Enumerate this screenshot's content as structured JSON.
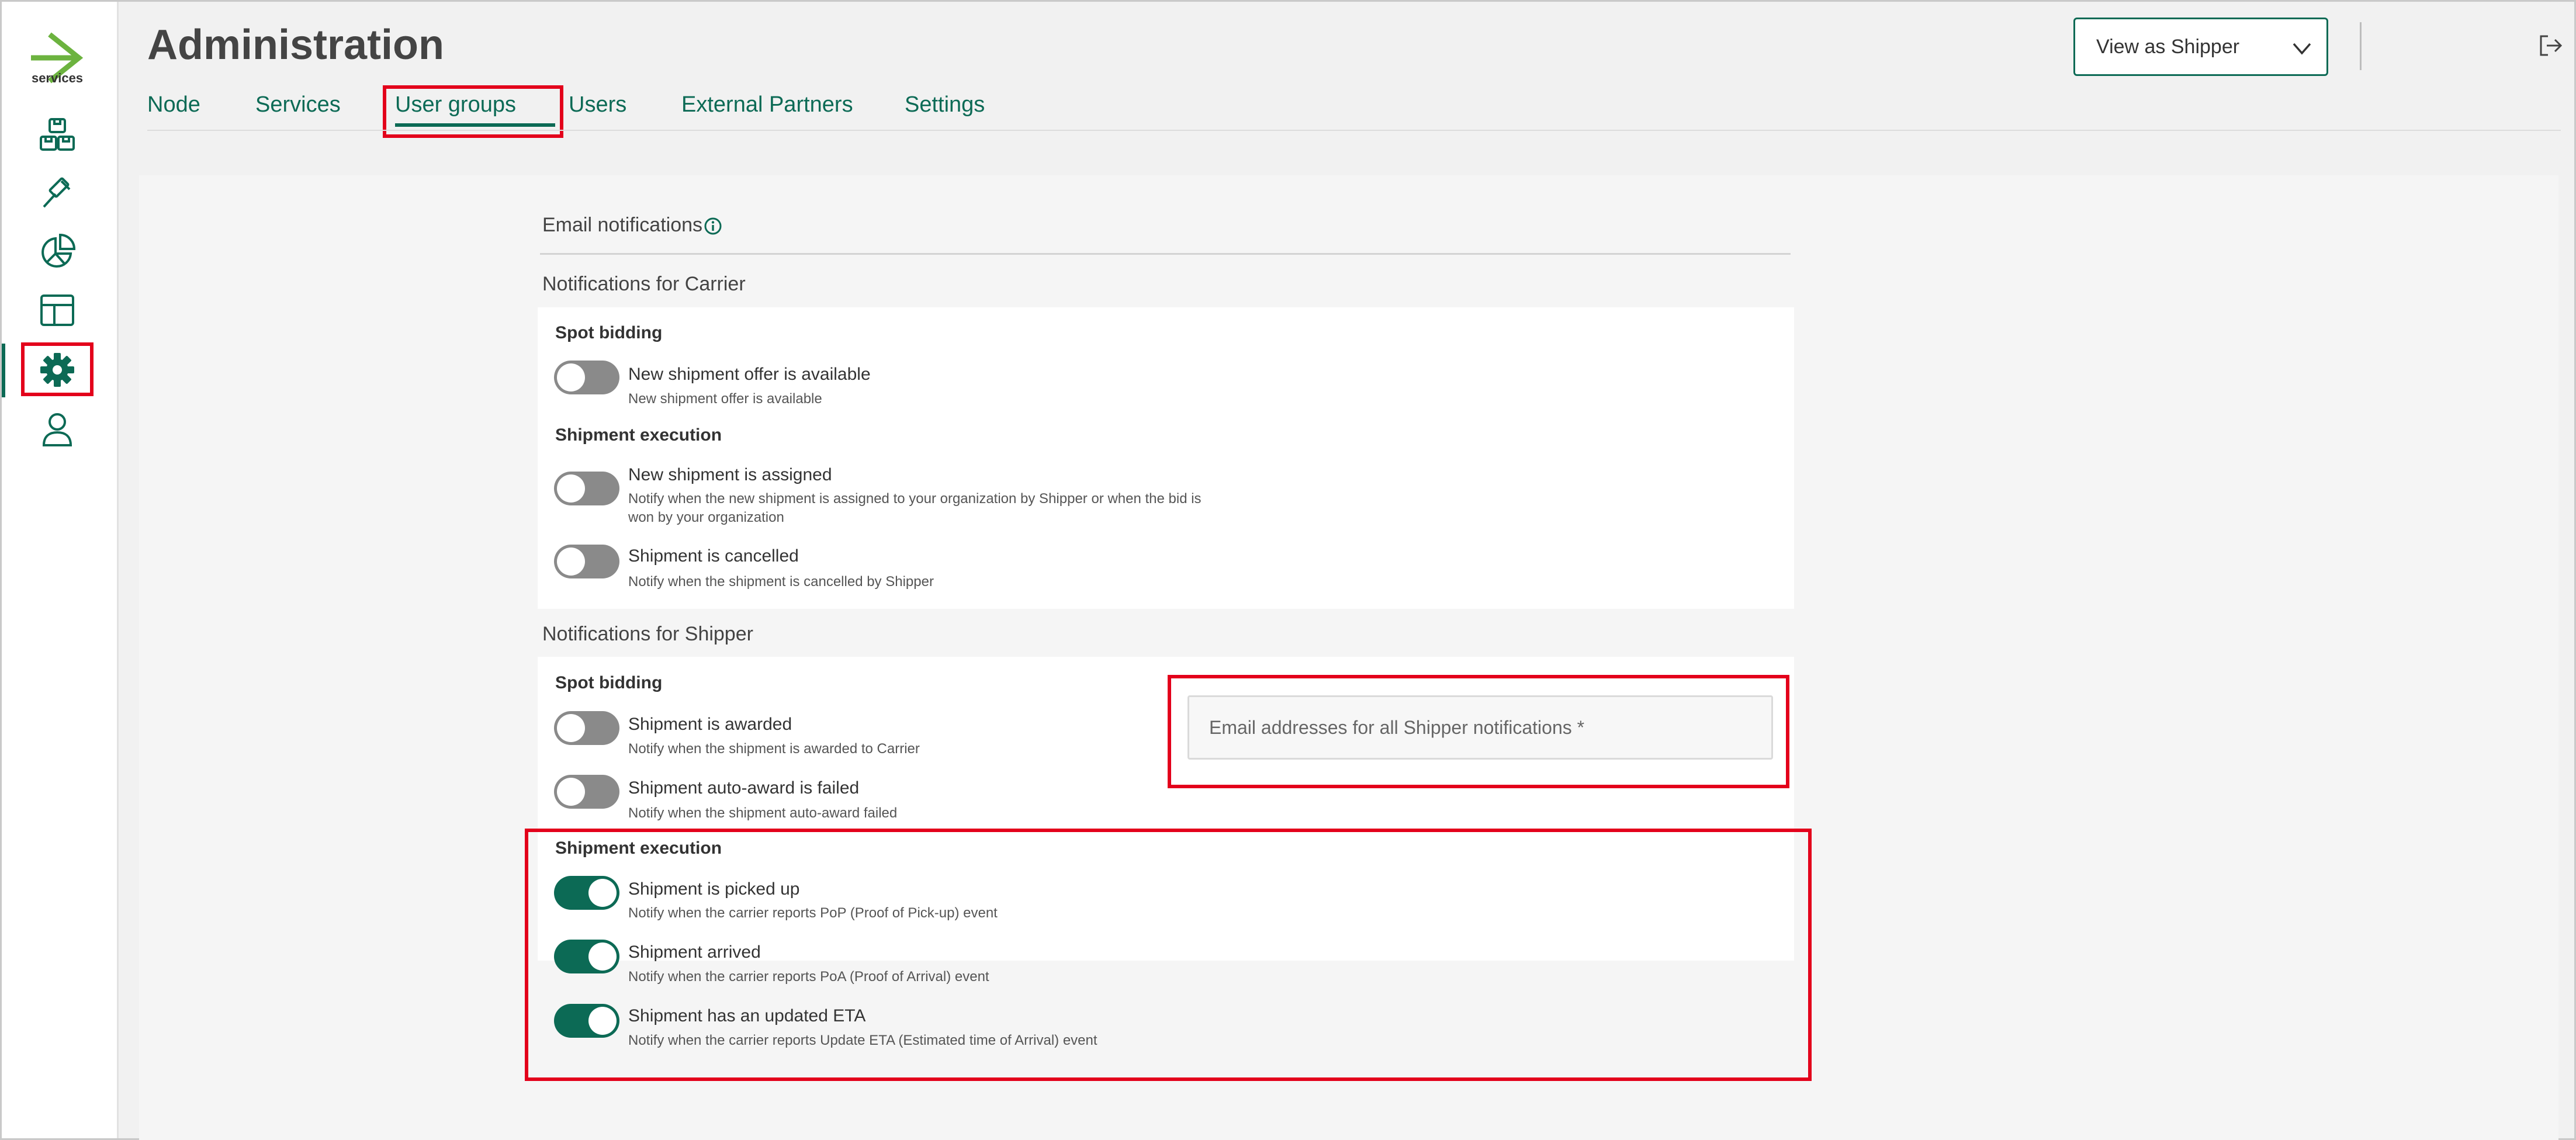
{
  "app": {
    "logo_text": "services",
    "page_title": "Administration"
  },
  "colors": {
    "accent": "#0c6a55",
    "logo_green": "#6cb33f",
    "highlight": "#e3001b"
  },
  "sidebar": {
    "items": [
      {
        "icon": "packages-icon"
      },
      {
        "icon": "gavel-icon"
      },
      {
        "icon": "pie-chart-icon"
      },
      {
        "icon": "layout-icon"
      },
      {
        "icon": "gear-icon",
        "active": true
      },
      {
        "icon": "user-icon"
      }
    ]
  },
  "tabs": [
    {
      "label": "Node"
    },
    {
      "label": "Services"
    },
    {
      "label": "User groups",
      "active": true
    },
    {
      "label": "Users"
    },
    {
      "label": "External Partners"
    },
    {
      "label": "Settings"
    }
  ],
  "header": {
    "view_select": "View as Shipper"
  },
  "email_notifications": {
    "heading": "Email notifications",
    "carrier": {
      "heading": "Notifications for Carrier",
      "spot_bidding_title": "Spot bidding",
      "spot_bidding": [
        {
          "title": "New shipment offer is available",
          "desc": "New shipment offer is available",
          "on": false
        }
      ],
      "execution_title": "Shipment execution",
      "execution": [
        {
          "title": "New shipment is assigned",
          "desc": "Notify when the new shipment is assigned to your organization by Shipper or when the bid is won by your organization",
          "on": false
        },
        {
          "title": "Shipment is cancelled",
          "desc": "Notify when the shipment is cancelled by Shipper",
          "on": false
        }
      ]
    },
    "shipper": {
      "heading": "Notifications for Shipper",
      "spot_bidding_title": "Spot bidding",
      "spot_bidding": [
        {
          "title": "Shipment is awarded",
          "desc": "Notify when the shipment is awarded to Carrier",
          "on": false
        },
        {
          "title": "Shipment auto-award is failed",
          "desc": "Notify when the shipment auto-award failed",
          "on": false
        }
      ],
      "email_placeholder": "Email addresses for all Shipper notifications *",
      "execution_title": "Shipment execution",
      "execution": [
        {
          "title": "Shipment is picked up",
          "desc": "Notify when the carrier reports PoP (Proof of Pick-up) event",
          "on": true
        },
        {
          "title": "Shipment arrived",
          "desc": "Notify when the carrier reports PoA (Proof of Arrival) event",
          "on": true
        },
        {
          "title": "Shipment has an updated ETA",
          "desc": "Notify when the carrier reports Update ETA (Estimated time of Arrival) event",
          "on": true
        }
      ]
    }
  }
}
